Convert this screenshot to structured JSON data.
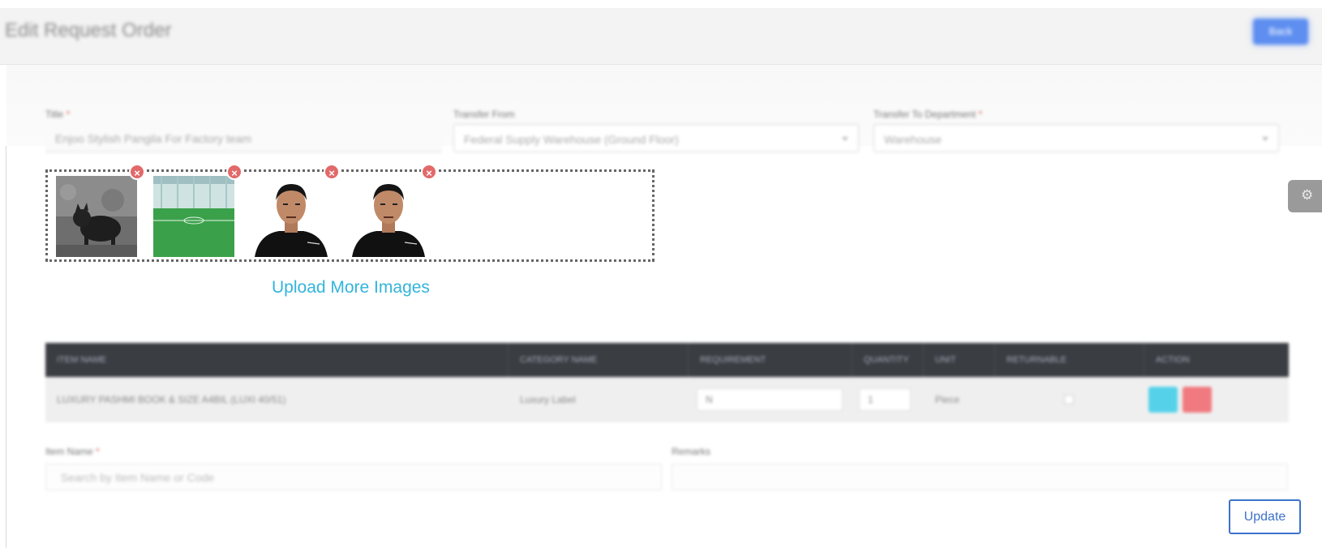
{
  "header": {
    "title": "Edit Request Order",
    "action_label": "Back"
  },
  "form": {
    "title_label": "Title",
    "title_value": "Enjoo Stylish Pangila For Factory team",
    "transfer_from_label": "Transfer From",
    "transfer_from_value": "Federal Supply Warehouse (Ground Floor)",
    "transfer_to_label": "Transfer To Department",
    "transfer_to_value": "Warehouse"
  },
  "images": {
    "items": [
      {
        "name": "cat-photo"
      },
      {
        "name": "football-field-photo"
      },
      {
        "name": "person-photo"
      },
      {
        "name": "person-photo"
      }
    ],
    "remove_symbol": "×",
    "upload_more_label": "Upload More Images"
  },
  "table": {
    "columns": [
      "ITEM NAME",
      "CATEGORY NAME",
      "REQUIREMENT",
      "QUANTITY",
      "UNIT",
      "RETURNABLE",
      "ACTION"
    ],
    "rows": [
      {
        "item_name": "LUXURY PASHMI BOOK & SIZE A4BIL (LUXI 40/51)",
        "category": "Luxury Label",
        "requirement": "N",
        "quantity": "1",
        "unit": "Piece"
      }
    ]
  },
  "bottom": {
    "item_name_label": "Item Name",
    "item_name_placeholder": "Search by Item Name or Code",
    "remarks_label": "Remarks"
  },
  "footer": {
    "update_label": "Update"
  },
  "colors": {
    "accent_blue": "#3c73c9",
    "link_cyan": "#33b4dc",
    "remove_red": "#e26969",
    "table_header": "#3a3d42"
  }
}
